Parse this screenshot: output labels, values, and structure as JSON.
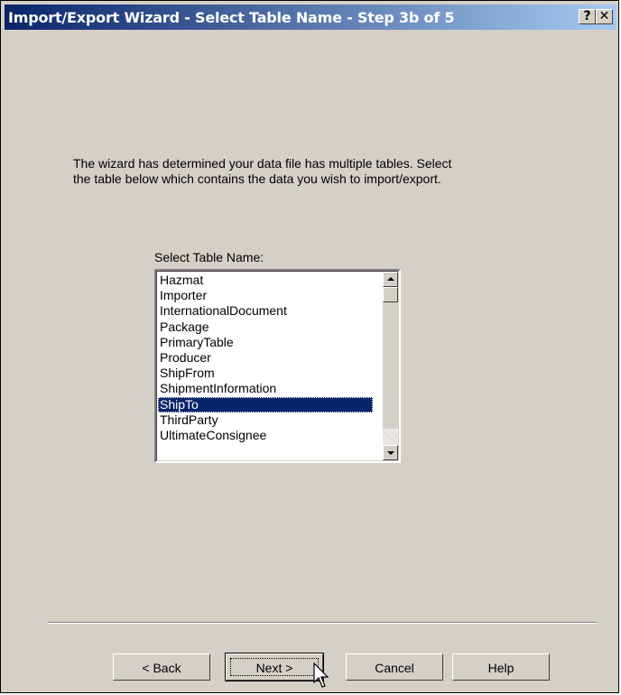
{
  "window": {
    "title": "Import/Export Wizard - Select Table Name - Step 3b of 5",
    "help_glyph": "?",
    "close_glyph": "✕"
  },
  "intro": {
    "line1": "The wizard has determined your data file has multiple tables. Select",
    "line2": "the table below which contains the data you wish to import/export."
  },
  "table_select": {
    "label": "Select Table Name:",
    "items": [
      "Hazmat",
      "Importer",
      "InternationalDocument",
      "Package",
      "PrimaryTable",
      "Producer",
      "ShipFrom",
      "ShipmentInformation",
      "ShipTo",
      "ThirdParty",
      "UltimateConsignee"
    ],
    "selected": "ShipTo"
  },
  "buttons": {
    "back": "< Back",
    "next": "Next >",
    "cancel": "Cancel",
    "help": "Help"
  },
  "icons": {
    "help": "help-icon",
    "close": "close-icon",
    "cursor": "mouse-pointer-icon"
  }
}
